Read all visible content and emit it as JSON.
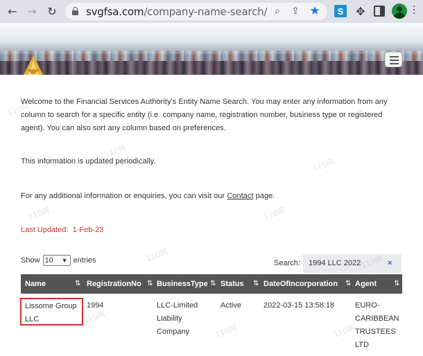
{
  "browser": {
    "url_host": "svgfsa.com",
    "url_path": "/company-name-search/",
    "extension_s_label": "S"
  },
  "intro": {
    "paragraph1": "Welcome to the Financial Services Authority's Entity Name Search. You may enter any information from any column to search for a specific entity (i.e. company name, registration number, business type or registered agent). You can also sort any column based on preferences.",
    "paragraph2": "This information is updated periodically.",
    "paragraph3_before": "For any additional information or enquiries, you can visit our ",
    "paragraph3_link": "Contact",
    "paragraph3_after": " page.",
    "last_updated_label": "Last Updated:",
    "last_updated_value": "1-Feb-23"
  },
  "controls": {
    "show_label": "Show",
    "entries_value": "10",
    "entries_label": "entries",
    "search_label": "Search:",
    "search_value": "1994 LLC 2022",
    "clear_label": "×"
  },
  "table": {
    "columns": [
      "Name",
      "RegistrationNo",
      "BusinessType",
      "Status",
      "DateOfIncorporation",
      "Agent"
    ],
    "rows": [
      {
        "name_line1": "Lissome Group",
        "name_line2": "LLC",
        "registration_no": "1994",
        "business_type_line1": "LLC-Limited",
        "business_type_line2": "Liability",
        "business_type_line3": "Company",
        "status": "Active",
        "date_of_incorporation": "2022-03-15 13:58:18",
        "agent_line1": "EURO-",
        "agent_line2": "CARIBBEAN",
        "agent_line3": "TRUSTEES",
        "agent_line4": "LTD"
      }
    ]
  },
  "watermark_text": "110网",
  "colors": {
    "header_bg": "#555555",
    "last_updated": "#c0392b",
    "highlight_border": "#d32f2f",
    "star": "#1a73e8"
  }
}
